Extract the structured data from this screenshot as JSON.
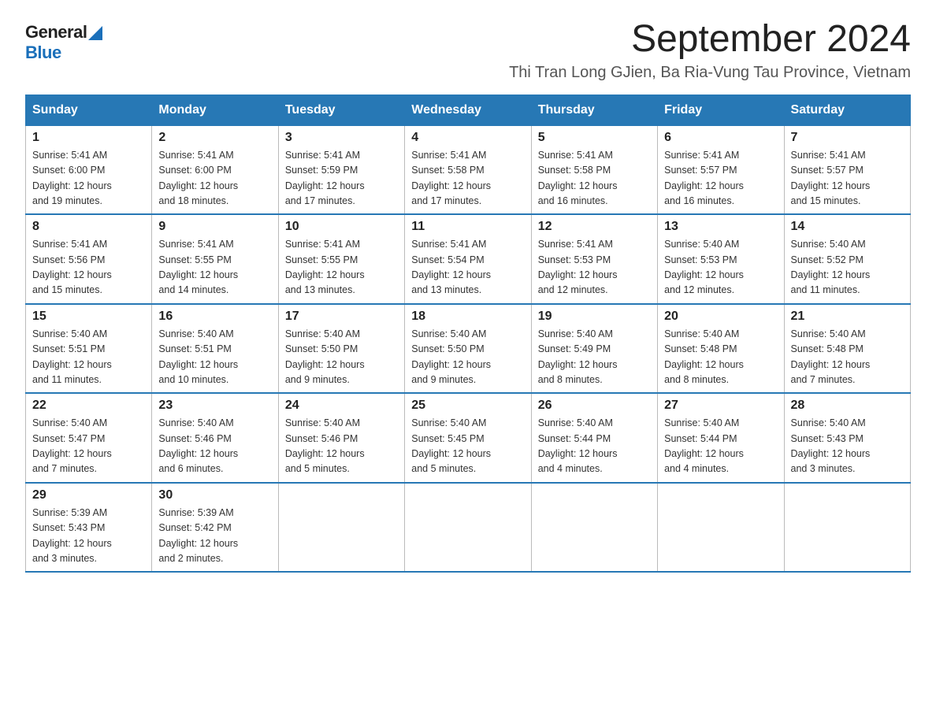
{
  "logo": {
    "general": "General",
    "blue": "Blue"
  },
  "title": "September 2024",
  "location": "Thi Tran Long GJien, Ba Ria-Vung Tau Province, Vietnam",
  "weekdays": [
    "Sunday",
    "Monday",
    "Tuesday",
    "Wednesday",
    "Thursday",
    "Friday",
    "Saturday"
  ],
  "weeks": [
    [
      {
        "day": "1",
        "sunrise": "5:41 AM",
        "sunset": "6:00 PM",
        "daylight": "12 hours and 19 minutes."
      },
      {
        "day": "2",
        "sunrise": "5:41 AM",
        "sunset": "6:00 PM",
        "daylight": "12 hours and 18 minutes."
      },
      {
        "day": "3",
        "sunrise": "5:41 AM",
        "sunset": "5:59 PM",
        "daylight": "12 hours and 17 minutes."
      },
      {
        "day": "4",
        "sunrise": "5:41 AM",
        "sunset": "5:58 PM",
        "daylight": "12 hours and 17 minutes."
      },
      {
        "day": "5",
        "sunrise": "5:41 AM",
        "sunset": "5:58 PM",
        "daylight": "12 hours and 16 minutes."
      },
      {
        "day": "6",
        "sunrise": "5:41 AM",
        "sunset": "5:57 PM",
        "daylight": "12 hours and 16 minutes."
      },
      {
        "day": "7",
        "sunrise": "5:41 AM",
        "sunset": "5:57 PM",
        "daylight": "12 hours and 15 minutes."
      }
    ],
    [
      {
        "day": "8",
        "sunrise": "5:41 AM",
        "sunset": "5:56 PM",
        "daylight": "12 hours and 15 minutes."
      },
      {
        "day": "9",
        "sunrise": "5:41 AM",
        "sunset": "5:55 PM",
        "daylight": "12 hours and 14 minutes."
      },
      {
        "day": "10",
        "sunrise": "5:41 AM",
        "sunset": "5:55 PM",
        "daylight": "12 hours and 13 minutes."
      },
      {
        "day": "11",
        "sunrise": "5:41 AM",
        "sunset": "5:54 PM",
        "daylight": "12 hours and 13 minutes."
      },
      {
        "day": "12",
        "sunrise": "5:41 AM",
        "sunset": "5:53 PM",
        "daylight": "12 hours and 12 minutes."
      },
      {
        "day": "13",
        "sunrise": "5:40 AM",
        "sunset": "5:53 PM",
        "daylight": "12 hours and 12 minutes."
      },
      {
        "day": "14",
        "sunrise": "5:40 AM",
        "sunset": "5:52 PM",
        "daylight": "12 hours and 11 minutes."
      }
    ],
    [
      {
        "day": "15",
        "sunrise": "5:40 AM",
        "sunset": "5:51 PM",
        "daylight": "12 hours and 11 minutes."
      },
      {
        "day": "16",
        "sunrise": "5:40 AM",
        "sunset": "5:51 PM",
        "daylight": "12 hours and 10 minutes."
      },
      {
        "day": "17",
        "sunrise": "5:40 AM",
        "sunset": "5:50 PM",
        "daylight": "12 hours and 9 minutes."
      },
      {
        "day": "18",
        "sunrise": "5:40 AM",
        "sunset": "5:50 PM",
        "daylight": "12 hours and 9 minutes."
      },
      {
        "day": "19",
        "sunrise": "5:40 AM",
        "sunset": "5:49 PM",
        "daylight": "12 hours and 8 minutes."
      },
      {
        "day": "20",
        "sunrise": "5:40 AM",
        "sunset": "5:48 PM",
        "daylight": "12 hours and 8 minutes."
      },
      {
        "day": "21",
        "sunrise": "5:40 AM",
        "sunset": "5:48 PM",
        "daylight": "12 hours and 7 minutes."
      }
    ],
    [
      {
        "day": "22",
        "sunrise": "5:40 AM",
        "sunset": "5:47 PM",
        "daylight": "12 hours and 7 minutes."
      },
      {
        "day": "23",
        "sunrise": "5:40 AM",
        "sunset": "5:46 PM",
        "daylight": "12 hours and 6 minutes."
      },
      {
        "day": "24",
        "sunrise": "5:40 AM",
        "sunset": "5:46 PM",
        "daylight": "12 hours and 5 minutes."
      },
      {
        "day": "25",
        "sunrise": "5:40 AM",
        "sunset": "5:45 PM",
        "daylight": "12 hours and 5 minutes."
      },
      {
        "day": "26",
        "sunrise": "5:40 AM",
        "sunset": "5:44 PM",
        "daylight": "12 hours and 4 minutes."
      },
      {
        "day": "27",
        "sunrise": "5:40 AM",
        "sunset": "5:44 PM",
        "daylight": "12 hours and 4 minutes."
      },
      {
        "day": "28",
        "sunrise": "5:40 AM",
        "sunset": "5:43 PM",
        "daylight": "12 hours and 3 minutes."
      }
    ],
    [
      {
        "day": "29",
        "sunrise": "5:39 AM",
        "sunset": "5:43 PM",
        "daylight": "12 hours and 3 minutes."
      },
      {
        "day": "30",
        "sunrise": "5:39 AM",
        "sunset": "5:42 PM",
        "daylight": "12 hours and 2 minutes."
      },
      null,
      null,
      null,
      null,
      null
    ]
  ]
}
